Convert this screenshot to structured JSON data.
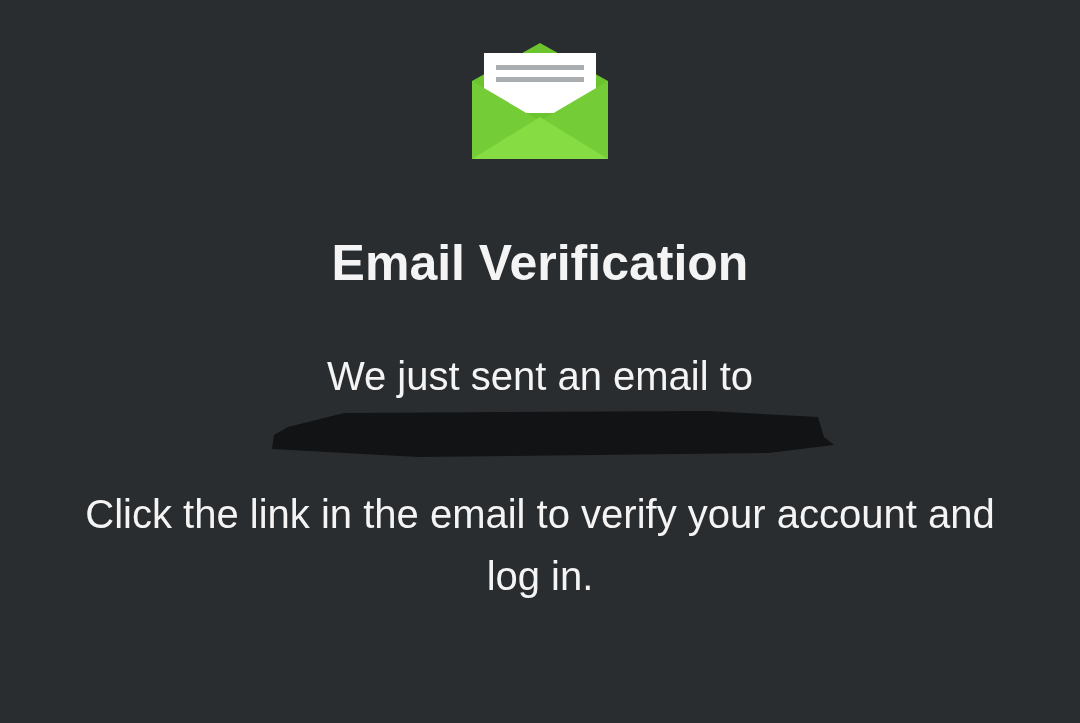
{
  "title": "Email Verification",
  "sent_line": "We just sent an email to",
  "instructions": "Click the link in the email to verify your account and log in."
}
